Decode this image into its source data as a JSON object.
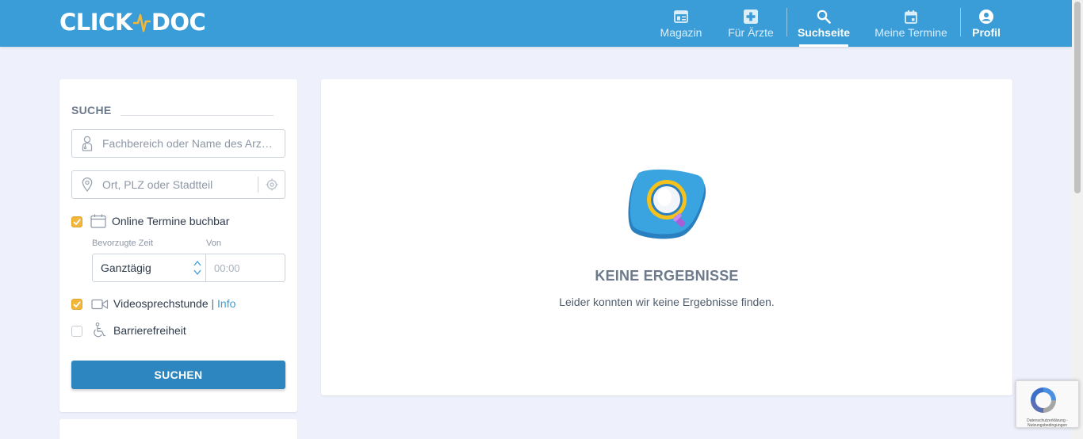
{
  "header": {
    "logo_left": "CLICK",
    "logo_right": "DOC",
    "nav": [
      {
        "label": "Magazin",
        "icon": "newspaper-icon"
      },
      {
        "label": "Für Ärzte",
        "icon": "medical-cross-icon"
      },
      {
        "label": "Suchseite",
        "icon": "search-icon",
        "active": true
      },
      {
        "label": "Meine Termine",
        "icon": "calendar-icon"
      },
      {
        "label": "Profil",
        "icon": "user-circle-icon"
      }
    ]
  },
  "search": {
    "title": "SUCHE",
    "specialty_placeholder": "Fachbereich oder Name des Arz…",
    "location_placeholder": "Ort, PLZ oder Stadtteil",
    "online_booking": {
      "label": "Online Termine buchbar",
      "checked": true
    },
    "preferred_time_label": "Bevorzugte Zeit",
    "from_label": "Von",
    "preferred_time_value": "Ganztägig",
    "from_placeholder": "00:00",
    "video": {
      "label": "Videosprechstunde",
      "separator": "|",
      "info": "Info",
      "checked": true
    },
    "accessibility": {
      "label": "Barrierefreiheit",
      "checked": false
    },
    "submit": "SUCHEN"
  },
  "results": {
    "empty_title": "KEINE ERGEBNISSE",
    "empty_text": "Leider konnten wir keine Ergebnisse finden."
  },
  "recaptcha": {
    "text_line1": "Datenschutzerklärung -",
    "text_line2": "Nutzungsbedingungen"
  },
  "colors": {
    "header": "#3a9dd8",
    "background": "#eef1fb",
    "checkbox": "#f2b73a",
    "button": "#2e86c1",
    "link": "#3a9dd8"
  }
}
